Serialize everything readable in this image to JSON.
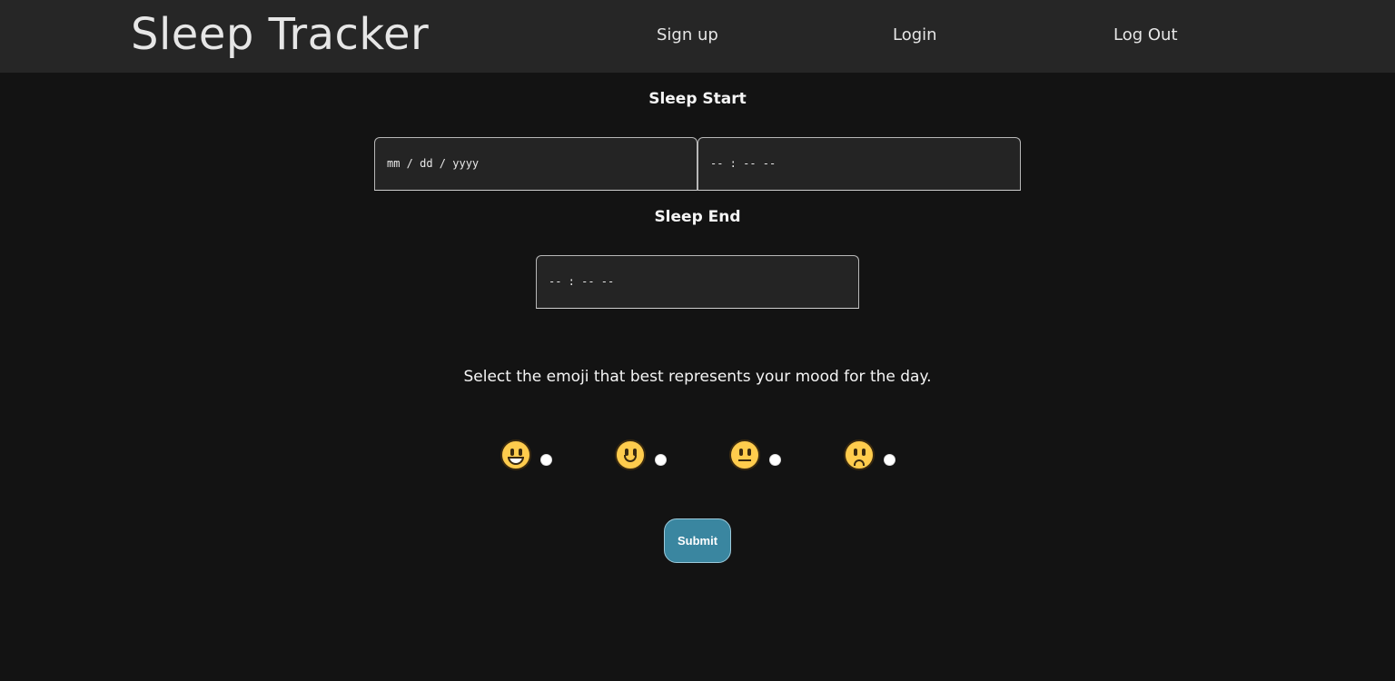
{
  "navbar": {
    "brand": "Sleep Tracker",
    "links": [
      "Sign up",
      "Login",
      "Log Out"
    ]
  },
  "form": {
    "sleep_start_label": "Sleep Start",
    "date_placeholder": "mm / dd / yyyy",
    "time_placeholder": "-- : --  --",
    "sleep_end_label": "Sleep End",
    "end_time_placeholder": "-- : --  --",
    "mood_prompt": "Select the emoji that best represents your mood for the day.",
    "moods": [
      {
        "icon": "grinning-face-icon"
      },
      {
        "icon": "slightly-smiling-face-icon"
      },
      {
        "icon": "neutral-face-icon"
      },
      {
        "icon": "slightly-frowning-face-icon"
      }
    ],
    "submit_label": "Submit"
  },
  "colors": {
    "background": "#131313",
    "navbar": "#262626",
    "input_bg": "#242424",
    "submit_bg": "#3a86a0",
    "emoji_yellow": "#ffcc4d"
  }
}
